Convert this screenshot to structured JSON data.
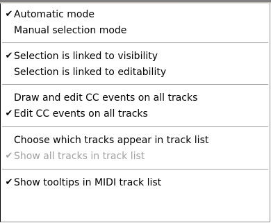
{
  "menu": {
    "items": [
      {
        "label": "Automatic mode",
        "check": "✔"
      },
      {
        "label": "Manual selection mode",
        "check": ""
      },
      {
        "label": "Selection is linked to visibility",
        "check": "✔"
      },
      {
        "label": "Selection is linked to editability",
        "check": ""
      },
      {
        "label": "Draw and edit CC events on all tracks",
        "check": ""
      },
      {
        "label": "Edit CC events on all tracks",
        "check": "✔"
      },
      {
        "label": "Choose which tracks appear in track list",
        "check": ""
      },
      {
        "label": "Show all tracks in track list",
        "check": "✔",
        "disabled": true
      },
      {
        "label": "Show tooltips in MIDI track list",
        "check": "✔"
      }
    ]
  },
  "colors": {
    "text": "#000000",
    "disabled_text": "#a0a0a0",
    "separator": "#a0a0a0",
    "background": "#ffffff"
  }
}
